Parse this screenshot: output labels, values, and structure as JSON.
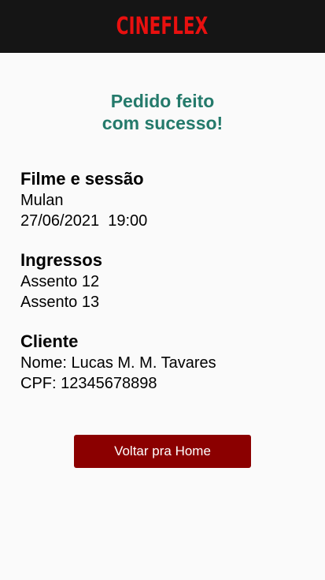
{
  "header": {
    "logo": "CINEFLEX"
  },
  "success_message": {
    "line1": "Pedido feito",
    "line2": "com sucesso!"
  },
  "movie_section": {
    "title": "Filme e sessão",
    "movie": "Mulan",
    "datetime": "27/06/2021  19:00"
  },
  "tickets_section": {
    "title": "Ingressos",
    "seats": [
      "Assento 12",
      "Assento 13"
    ]
  },
  "client_section": {
    "title": "Cliente",
    "name": "Nome: Lucas M. M. Tavares",
    "cpf": "CPF: 12345678898"
  },
  "home_button": {
    "label": "Voltar pra Home"
  },
  "colors": {
    "header_bg": "#151515",
    "logo": "#e8100f",
    "success": "#247a6b",
    "button_bg": "#8b0000"
  }
}
